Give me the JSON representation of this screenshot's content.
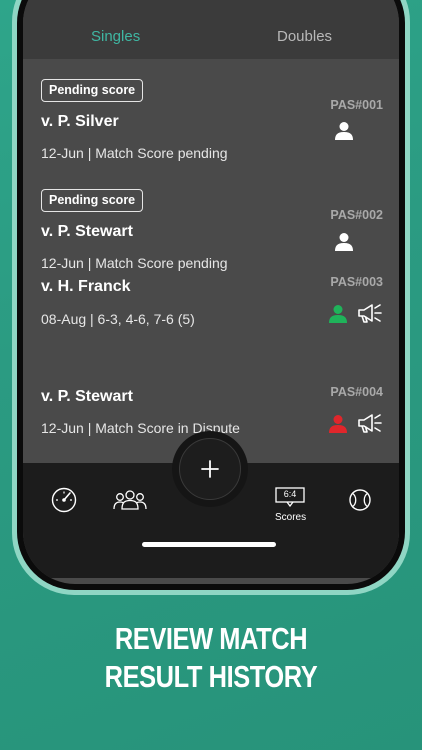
{
  "tabs": {
    "singles": "Singles",
    "doubles": "Doubles"
  },
  "matches": [
    {
      "badge": "Pending score",
      "opponent": "v. P. Silver",
      "detail": "12-Jun | Match Score pending",
      "id": "PAS#001",
      "player_status": "white",
      "dispute_icon": false
    },
    {
      "badge": "Pending score",
      "opponent": "v. P. Stewart",
      "detail": "12-Jun | Match Score pending",
      "id": "PAS#002",
      "player_status": "white",
      "dispute_icon": false
    },
    {
      "badge": "",
      "opponent": "v. H. Franck",
      "detail": "08-Aug | 6-3, 4-6, 7-6 (5)",
      "id": "PAS#003",
      "player_status": "green",
      "dispute_icon": true
    },
    {
      "badge": "",
      "opponent": "v. P. Stewart",
      "detail": "12-Jun | Match Score in Dispute",
      "id": "PAS#004",
      "player_status": "red",
      "dispute_icon": true
    }
  ],
  "nav": {
    "scores_icon_text": "6:4",
    "scores_label": "Scores",
    "add_icon": "plus-icon"
  },
  "colors": {
    "accent": "#3fb6a2",
    "status_green": "#1fb35a",
    "status_red": "#e0262b",
    "background": "#2ea58a"
  },
  "headline": {
    "line1": "REVIEW MATCH",
    "line2": "RESULT HISTORY"
  }
}
